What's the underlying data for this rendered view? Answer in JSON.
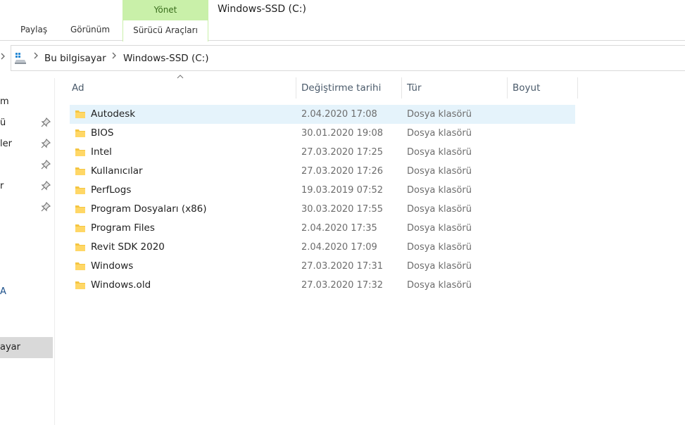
{
  "ribbon": {
    "context_header": "Yönet",
    "tabs": [
      {
        "label": "Paylaş"
      },
      {
        "label": "Görünüm"
      },
      {
        "label": "Sürücü Araçları"
      }
    ],
    "window_title": "Windows-SSD (C:)"
  },
  "address": {
    "crumbs": [
      "Bu bilgisayar",
      "Windows-SSD (C:)"
    ]
  },
  "nav": {
    "items": [
      {
        "label": "m",
        "pinned": false
      },
      {
        "label": "ü",
        "pinned": true
      },
      {
        "label": "ler",
        "pinned": true
      },
      {
        "label": "",
        "pinned": true
      },
      {
        "label": "r",
        "pinned": true
      },
      {
        "label": "",
        "pinned": true
      },
      {
        "label": "A",
        "pinned": false
      },
      {
        "label": "ayar",
        "pinned": false
      }
    ]
  },
  "columns": {
    "name": "Ad",
    "date": "Değiştirme tarihi",
    "type": "Tür",
    "size": "Boyut"
  },
  "files": [
    {
      "name": "Autodesk",
      "date": "2.04.2020 17:08",
      "type": "Dosya klasörü"
    },
    {
      "name": "BIOS",
      "date": "30.01.2020 19:08",
      "type": "Dosya klasörü"
    },
    {
      "name": "Intel",
      "date": "27.03.2020 17:25",
      "type": "Dosya klasörü"
    },
    {
      "name": "Kullanıcılar",
      "date": "27.03.2020 17:26",
      "type": "Dosya klasörü"
    },
    {
      "name": "PerfLogs",
      "date": "19.03.2019 07:52",
      "type": "Dosya klasörü"
    },
    {
      "name": "Program Dosyaları (x86)",
      "date": "30.03.2020 17:55",
      "type": "Dosya klasörü"
    },
    {
      "name": "Program Files",
      "date": "2.04.2020 17:35",
      "type": "Dosya klasörü"
    },
    {
      "name": "Revit SDK 2020",
      "date": "2.04.2020 17:09",
      "type": "Dosya klasörü"
    },
    {
      "name": "Windows",
      "date": "27.03.2020 17:31",
      "type": "Dosya klasörü"
    },
    {
      "name": "Windows.old",
      "date": "27.03.2020 17:32",
      "type": "Dosya klasörü"
    }
  ],
  "colors": {
    "context_tab": "#c9f0a9",
    "selection": "#e5f3fb",
    "folder": "#f4c541"
  }
}
